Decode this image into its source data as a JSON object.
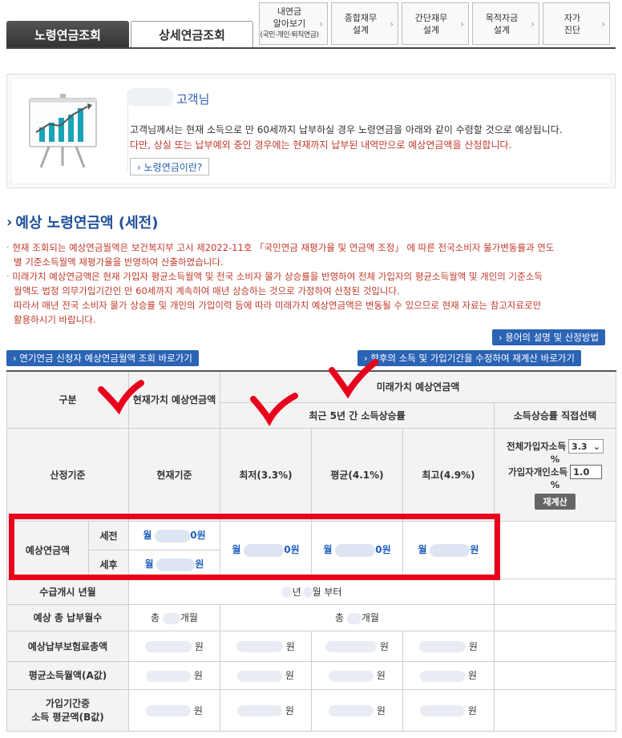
{
  "tabs": {
    "main": [
      {
        "label": "노령연금조회",
        "active": true
      },
      {
        "label": "상세연금조회",
        "active": false
      }
    ],
    "small": [
      {
        "line1": "내연금",
        "line2": "알아보기",
        "line3": "(국민·개인·퇴직연금)"
      },
      {
        "line1": "종합재무",
        "line2": "설계"
      },
      {
        "line1": "간단재무",
        "line2": "설계"
      },
      {
        "line1": "목적자금",
        "line2": "설계"
      },
      {
        "line1": "자가",
        "line2": "진단"
      }
    ]
  },
  "info": {
    "customer_suffix": "고객님",
    "text1": "고객님께서는 현재 소득으로 만 60세까지 납부하실 경우 노령연금을 아래와 같이 수령할 것으로 예상됩니다.",
    "text2": "다만, 상실 또는 납부예외 중인 경우에는 현재까지 납부된 내역만으로 예상연금액을 산정합니다.",
    "what_button": "› 노령연금이란?"
  },
  "section": {
    "title": "예상 노령연금액 (세전)",
    "notes": [
      "현재 조회되는 예상연금월액은 보건복지부 고시 제2022-11호 「국민연금 재평가율 및 연금액 조정」 에 따른 전국소비자 물가변동률과 연도",
      "별 기준소득월액 재평가율을 반영하여 산출하였습니다.",
      "미래가치 예상연금액은 현재 가입자 평균소득월액 및 전국 소비자 물가 상승률을 반영하여 전체 가입자의 평균소득월액 및 개인의 기준소득",
      "월액도 법정 의무가입기간인 만 60세까지 계속하여 매년 상승하는 것으로 가정하여 산정된 것입니다.",
      "따라서 매년 전국 소비자 물가 상승률 및 개인의 가입이력 등에 따라 미래가치 예상연금액은 변동될 수 있으므로 현재 자료는 참고자료로만",
      "활용하시기 바랍니다."
    ],
    "btn_terms": "› 용어의 설명 및 산정방법",
    "btn_deferred": "› 연기연금 신청자 예상연금월액 조회 바로가기",
    "btn_recalc": "› 향후의 소득 및 가입기간을 수정하여 재계산 바로가기"
  },
  "table": {
    "h_category": "구분",
    "h_current": "현재가치 예상연금액",
    "h_future": "미래가치 예상연금액",
    "h_recent5": "최근 5년 간 소득상승률",
    "h_direct": "소득상승률 직접선택",
    "basis_label": "산정기준",
    "basis_current": "현재기준",
    "basis_low": "최저(3.3%)",
    "basis_avg": "평균(4.1%)",
    "basis_high": "최고(4.9%)",
    "ctrl_all_label": "전체가입자소득",
    "ctrl_all_value": "3.3",
    "ctrl_pct": "%",
    "ctrl_personal_label": "가입자개인소득",
    "ctrl_personal_value": "1.0",
    "ctrl_recalc": "재계산",
    "expected_label": "예상연금액",
    "pretax": "세전",
    "aftertax": "세후",
    "month": "월",
    "won_unit": "원",
    "won_suffix0": "0원",
    "start_label": "수급개시 년월",
    "start_year": "년",
    "start_month": "월 부터",
    "months_label": "예상 총 납부월수",
    "months_prefix": "총",
    "months_suffix": "개월",
    "premium_label": "예상납부보험료총액",
    "a_label": "평균소득월액(A값)",
    "b_label1": "가입기간중",
    "b_label2": "소득 평균액(B값)"
  }
}
